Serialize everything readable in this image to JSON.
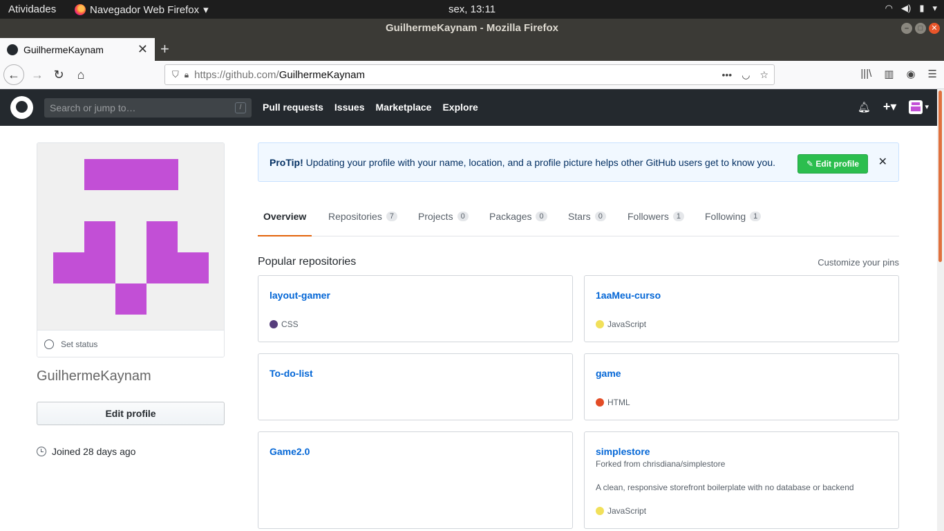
{
  "system": {
    "activities": "Atividades",
    "app_menu": "Navegador Web Firefox",
    "clock": "sex, 13:11"
  },
  "window": {
    "title": "GuilhermeKaynam - Mozilla Firefox"
  },
  "browser": {
    "tab_title": "GuilhermeKaynam",
    "url_host": "https://github.com/",
    "url_path": "GuilhermeKaynam"
  },
  "github_header": {
    "search_placeholder": "Search or jump to…",
    "search_shortcut": "/",
    "nav": [
      "Pull requests",
      "Issues",
      "Marketplace",
      "Explore"
    ]
  },
  "profile": {
    "set_status": "Set status",
    "username": "GuilhermeKaynam",
    "edit_profile": "Edit profile",
    "joined": "Joined 28 days ago"
  },
  "protip": {
    "label": "ProTip!",
    "text": " Updating your profile with your name, location, and a profile picture helps other GitHub users get to know you.",
    "button": "Edit profile",
    "close": "✕"
  },
  "tabs": [
    {
      "label": "Overview",
      "count": ""
    },
    {
      "label": "Repositories",
      "count": "7"
    },
    {
      "label": "Projects",
      "count": "0"
    },
    {
      "label": "Packages",
      "count": "0"
    },
    {
      "label": "Stars",
      "count": "0"
    },
    {
      "label": "Followers",
      "count": "1"
    },
    {
      "label": "Following",
      "count": "1"
    }
  ],
  "popular": {
    "title": "Popular repositories",
    "customize": "Customize your pins",
    "repos": [
      {
        "name": "layout-gamer",
        "lang": "CSS",
        "color": "#563d7c",
        "fork": "",
        "desc": ""
      },
      {
        "name": "1aaMeu-curso",
        "lang": "JavaScript",
        "color": "#f1e05a",
        "fork": "",
        "desc": ""
      },
      {
        "name": "To-do-list",
        "lang": "",
        "color": "",
        "fork": "",
        "desc": ""
      },
      {
        "name": "game",
        "lang": "HTML",
        "color": "#e34c26",
        "fork": "",
        "desc": ""
      },
      {
        "name": "Game2.0",
        "lang": "",
        "color": "",
        "fork": "",
        "desc": ""
      },
      {
        "name": "simplestore",
        "lang": "JavaScript",
        "color": "#f1e05a",
        "fork": "Forked from chrisdiana/simplestore",
        "desc": "A clean, responsive storefront boilerplate with no database or backend"
      }
    ]
  },
  "colors": {
    "avatar_magenta": "#c24fd6",
    "active_tab_accent": "#e36209",
    "link_blue": "#0366d6",
    "header_dark": "#24292e"
  }
}
